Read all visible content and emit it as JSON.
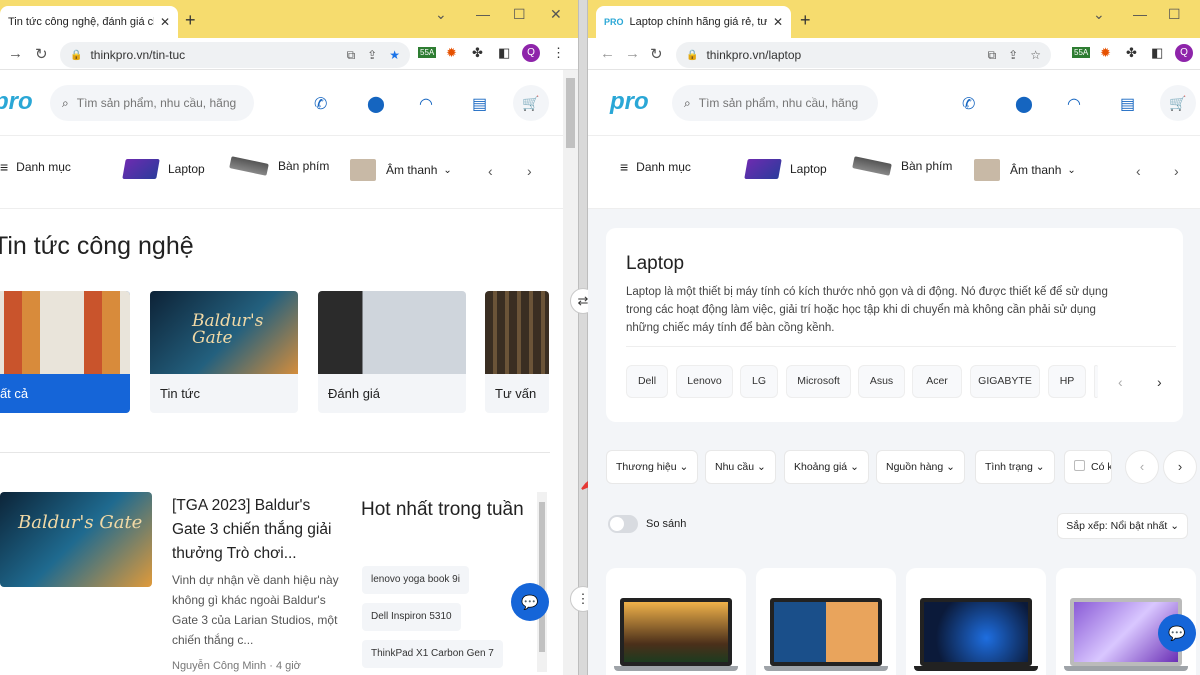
{
  "left": {
    "tab_title": "Tin tức công nghệ, đánh giá chi...",
    "url": "thinkpro.vn/tin-tuc",
    "logo": "pro",
    "search_placeholder": "Tìm sản phẩm, nhu cầu, hãng",
    "categories": {
      "menu": "Danh mục",
      "laptop": "Laptop",
      "keyboard": "Bàn phím",
      "audio": "Âm thanh"
    },
    "page_title": "Tin tức công nghệ",
    "news_categories": [
      "Tất cả",
      "Tin tức",
      "Đánh giá",
      "Tư vấn"
    ],
    "article": {
      "image_text": "Baldur's Gate",
      "title": "[TGA 2023] Baldur's Gate 3 chiến thắng giải thưởng Trò chơi...",
      "desc": "Vinh dự nhận về danh hiệu này không gì khác ngoài Baldur's Gate 3 của Larian Studios, một chiến thắng c...",
      "author": "Nguyễn Công Minh · 4 giờ"
    },
    "hot": {
      "title": "Hot nhất trong tuần",
      "tags": [
        "lenovo yoga book 9i",
        "Dell Inspiron 5310",
        "ThinkPad X1 Carbon Gen 7"
      ]
    },
    "news_images": {
      "tin_tuc": "Baldur's Gate"
    }
  },
  "right": {
    "tab_title": "Laptop chính hãng giá rẻ, tư vấn...",
    "url": "thinkpro.vn/laptop",
    "logo": "pro",
    "search_placeholder": "Tìm sản phẩm, nhu cầu, hãng",
    "categories": {
      "menu": "Danh mục",
      "laptop": "Laptop",
      "keyboard": "Bàn phím",
      "audio": "Âm thanh"
    },
    "intro_title": "Laptop",
    "intro_desc": "Laptop là một thiết bị máy tính có kích thước nhỏ gọn và di động. Nó được thiết kế để sử dụng trong các hoạt động làm việc, giải trí hoặc học tập khi di chuyển mà không cần phải sử dụng những chiếc máy tính để bàn cồng kềnh.",
    "brands": [
      "Dell",
      "Lenovo",
      "LG",
      "Microsoft",
      "Asus",
      "Acer",
      "GIGABYTE",
      "HP"
    ],
    "filters": [
      "Thương hiệu",
      "Nhu cầu",
      "Khoảng giá",
      "Nguồn hàng",
      "Tình trạng",
      "Có k"
    ],
    "compare_label": "So sánh",
    "sort_label": "Sắp xếp: Nổi bật nhất"
  },
  "profile_initial": "Q",
  "extension_badge": "55A",
  "colors": {
    "tabstrip": "#f6dc6e",
    "brand_blue": "#1565d8",
    "logo": "#2aa7d6"
  }
}
